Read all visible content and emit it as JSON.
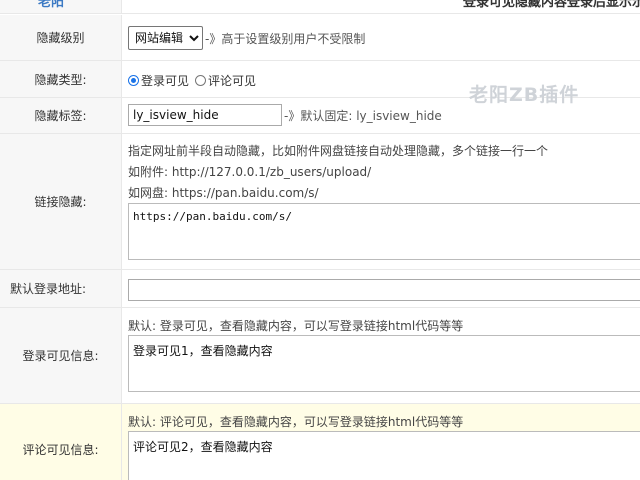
{
  "top": {
    "left_text": "老阳",
    "right_text": "登录可见隐藏内容登录后显示示"
  },
  "rows": {
    "hide_level": {
      "label": "隐藏级别",
      "select_value": "网站编辑",
      "hint": "-》高于设置级别用户不受限制"
    },
    "hide_type": {
      "label": "隐藏类型:",
      "options": [
        "登录可见",
        "评论可见"
      ],
      "selected": "登录可见"
    },
    "hide_tag": {
      "label": "隐藏标签:",
      "value": "ly_isview_hide",
      "hint": "-》默认固定: ly_isview_hide"
    },
    "link_hide": {
      "label": "链接隐藏:",
      "lines": [
        "指定网址前半段自动隐藏，比如附件网盘链接自动处理隐藏，多个链接一行一个",
        "如附件: http://127.0.0.1/zb_users/upload/",
        "如网盘: https://pan.baidu.com/s/"
      ],
      "textarea_value": "https://pan.baidu.com/s/"
    },
    "login_url": {
      "label": "默认登录地址:",
      "value": ""
    },
    "login_info": {
      "label": "登录可见信息:",
      "hint": "默认: 登录可见，查看隐藏内容，可以写登录链接html代码等等",
      "textarea_value": "登录可见1，查看隐藏内容"
    },
    "comment_info": {
      "label": "评论可见信息:",
      "hint": "默认: 评论可见，查看隐藏内容，可以写登录链接html代码等等",
      "textarea_value": "评论可见2，查看隐藏内容"
    }
  },
  "watermark": "老阳ZB插件",
  "colors": {
    "label_bg": "#f7f7f7",
    "highlight_bg": "#fffde6",
    "radio_accent": "#1a73e8"
  }
}
